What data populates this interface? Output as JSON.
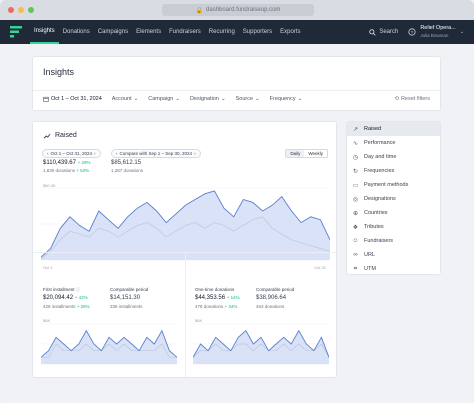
{
  "browser": {
    "url": "dashboard.fundraiseup.com"
  },
  "nav": {
    "items": [
      "Insights",
      "Donations",
      "Campaigns",
      "Elements",
      "Fundraisers",
      "Recurring",
      "Supporters",
      "Exports"
    ],
    "search_label": "Search",
    "account_name": "Relief Opera...",
    "account_user": "Julia Bowman"
  },
  "insights": {
    "title": "Insights",
    "date_range": "Oct 1 – Oct 31, 2024",
    "filters": [
      "Account",
      "Campaign",
      "Designation",
      "Source",
      "Frequency"
    ],
    "reset_label": "Reset filters"
  },
  "raised": {
    "title": "Raised",
    "range_pill": "Oct 1 – Oct 31, 2024",
    "compare_pill": "Compare with Sep 1 – Sep 30, 2024",
    "toggle": [
      "Daily",
      "Weekly"
    ],
    "current_value": "$110,439.67",
    "current_change": "+ 29%",
    "current_donations": "1,830 donations",
    "current_donations_change": "+ 53%",
    "compare_value": "$85,612.15",
    "compare_donations": "1,287 donations",
    "y_top_label": "$50.3K",
    "x_start": "Oct 1",
    "x_end": "Oct 31"
  },
  "first_installment": {
    "label": "First installment",
    "value": "$20,094.42",
    "change": "+ 42%",
    "count": "428 installments",
    "count_change": "+ 28%",
    "comp_label": "Comparable period",
    "comp_value": "$14,151.30",
    "comp_count": "335 installments",
    "y_label": "$6K"
  },
  "one_time": {
    "label": "One-time donations",
    "value": "$44,353.56",
    "change": "+ 14%",
    "count": "478 donations",
    "count_change": "+ 34%",
    "comp_label": "Comparable period",
    "comp_value": "$38,906.64",
    "comp_count": "463 donations",
    "y_label": "$6K"
  },
  "sidebar": {
    "items": [
      {
        "label": "Raised",
        "icon": "trend-icon"
      },
      {
        "label": "Performance",
        "icon": "pulse-icon"
      },
      {
        "label": "Day and time",
        "icon": "clock-icon"
      },
      {
        "label": "Frequencies",
        "icon": "repeat-icon"
      },
      {
        "label": "Payment methods",
        "icon": "card-icon"
      },
      {
        "label": "Designations",
        "icon": "target-icon"
      },
      {
        "label": "Countries",
        "icon": "globe-icon"
      },
      {
        "label": "Tributes",
        "icon": "gift-icon"
      },
      {
        "label": "Fundraisers",
        "icon": "people-icon"
      },
      {
        "label": "URL",
        "icon": "link-icon"
      },
      {
        "label": "UTM",
        "icon": "tag-icon"
      }
    ]
  },
  "colors": {
    "nav_bg": "#1f2937",
    "accent": "#34d399",
    "series_main": "#5b7fcf",
    "series_compare": "#9aa3b2"
  },
  "chart_data": [
    {
      "type": "area",
      "title": "Raised",
      "x": [
        1,
        2,
        3,
        4,
        5,
        6,
        7,
        8,
        9,
        10,
        11,
        12,
        13,
        14,
        15,
        16,
        17,
        18,
        19,
        20,
        21,
        22,
        23,
        24,
        25,
        26,
        27,
        28,
        29,
        30,
        31
      ],
      "series": [
        {
          "name": "Oct 1 – Oct 31, 2024",
          "values": [
            2,
            8,
            22,
            30,
            24,
            20,
            34,
            28,
            22,
            30,
            36,
            40,
            34,
            26,
            32,
            38,
            42,
            46,
            48,
            36,
            30,
            42,
            40,
            34,
            38,
            44,
            34,
            26,
            30,
            28,
            14
          ]
        },
        {
          "name": "Compare with Sep 1 – Sep 30, 2024",
          "values": [
            1,
            6,
            14,
            20,
            18,
            16,
            22,
            20,
            16,
            20,
            24,
            26,
            22,
            16,
            20,
            24,
            26,
            22,
            26,
            24,
            20,
            24,
            28,
            30,
            22,
            18,
            14,
            12,
            10,
            8,
            6
          ]
        }
      ]
    },
    {
      "type": "area",
      "title": "First installment",
      "series": [
        {
          "name": "Oct 1 – Oct 31, 2024",
          "values": [
            1,
            2,
            4,
            3,
            2,
            3,
            5,
            3,
            2,
            4,
            3,
            4,
            3,
            2,
            4,
            3,
            5,
            2,
            1
          ]
        },
        {
          "name": "Comparable period",
          "values": [
            1,
            1,
            3,
            2,
            2,
            2,
            3,
            2,
            2,
            3,
            2,
            3,
            2,
            2,
            2,
            2,
            3,
            1,
            1
          ]
        }
      ]
    },
    {
      "type": "area",
      "title": "One-time donations",
      "series": [
        {
          "name": "Oct 1 – Oct 31, 2024",
          "values": [
            1,
            3,
            2,
            4,
            3,
            2,
            4,
            5,
            3,
            4,
            2,
            3,
            4,
            3,
            5,
            3,
            2,
            4,
            1
          ]
        },
        {
          "name": "Comparable period",
          "values": [
            1,
            2,
            2,
            3,
            2,
            2,
            3,
            3,
            2,
            3,
            2,
            2,
            3,
            2,
            3,
            2,
            2,
            3,
            1
          ]
        }
      ]
    }
  ]
}
